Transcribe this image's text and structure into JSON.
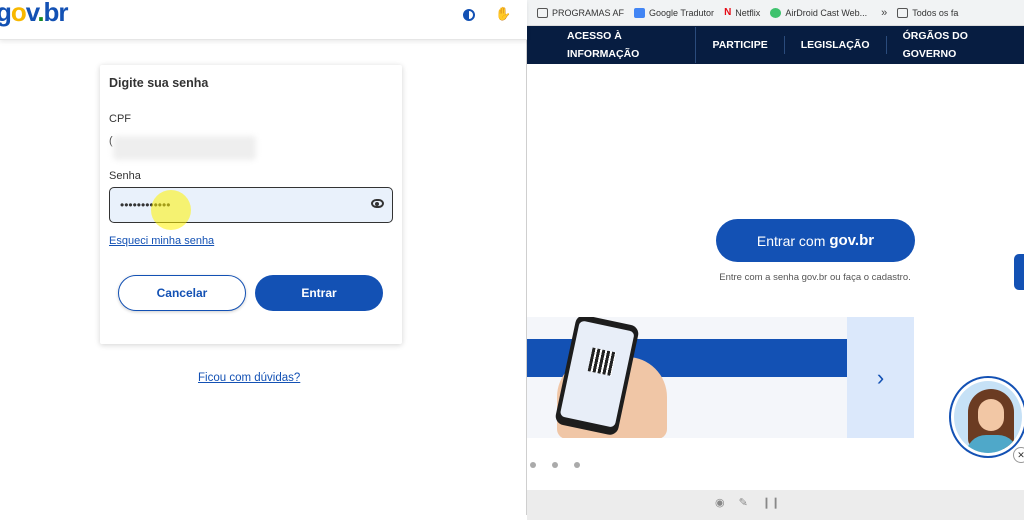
{
  "bookmarks": [
    {
      "label": "PROGRAMAS AF",
      "icon": "folder-icon"
    },
    {
      "label": "Google Tradutor",
      "icon": "google-translate-icon"
    },
    {
      "label": "Netflix",
      "icon": "netflix-icon"
    },
    {
      "label": "AirDroid Cast Web...",
      "icon": "airdroid-icon"
    },
    {
      "label": "Todos os fa",
      "icon": "folder-icon"
    }
  ],
  "bookmarks_more": "»",
  "gov_nav": [
    "ACESSO À INFORMAÇÃO",
    "PARTICIPE",
    "LEGISLAÇÃO",
    "ÓRGÃOS DO GOVERNO"
  ],
  "govbr_button": {
    "prefix": "Entrar com",
    "brand": "gov.br"
  },
  "govbr_subtitle": "Entre com a senha gov.br ou faça o cadastro.",
  "banner_next": "›",
  "logo": {
    "g": "g",
    "o": "o",
    "v": "v",
    "dot": ".",
    "br": "br"
  },
  "login": {
    "title": "Digite sua senha",
    "cpf_label": "CPF",
    "cpf_value": "(",
    "password_label": "Senha",
    "password_value": "••••••••••••",
    "forgot_link": "Esqueci minha senha",
    "cancel_button": "Cancelar",
    "enter_button": "Entrar",
    "help_link": "Ficou com dúvidas?"
  },
  "colors": {
    "primary": "#1351b4",
    "nav": "#071d41",
    "field_bg": "#e9f1fb"
  }
}
